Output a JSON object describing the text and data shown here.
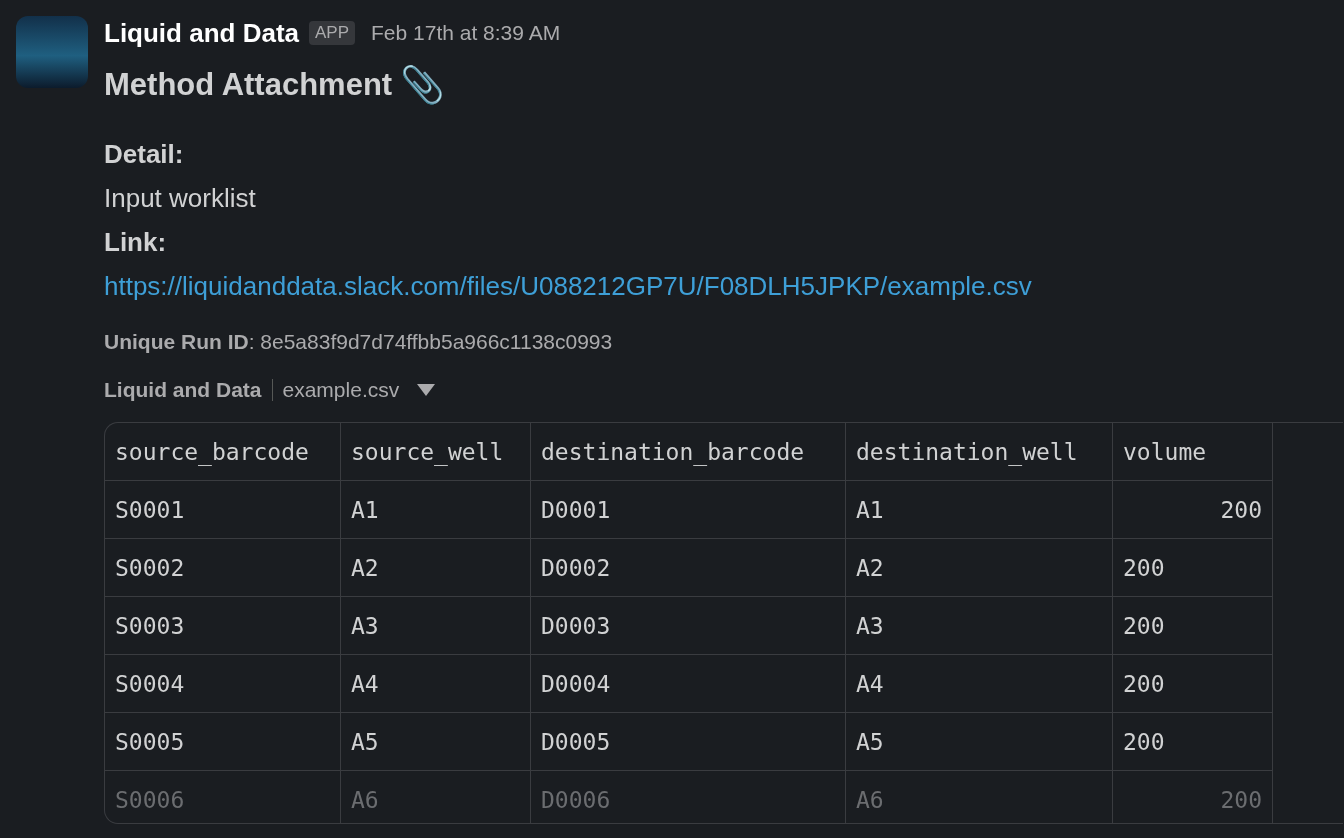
{
  "message": {
    "sender": "Liquid and Data",
    "badge": "APP",
    "time": "Feb 17th at 8:39 AM",
    "title": "Method Attachment",
    "title_emoji": "📎",
    "fields": [
      {
        "label": "Detail:",
        "value": "Input worklist",
        "kind": "text"
      },
      {
        "label": "Link:",
        "value": "https://liquidanddata.slack.com/files/U088212GP7U/F08DLH5JPKP/example.csv",
        "kind": "link"
      }
    ],
    "context": "**Unique Run ID**: 8e5a83f9d7d74ffbb5a966c1138c0993"
  },
  "attachment": {
    "source": "Liquid and Data",
    "filename": "example.csv",
    "table": {
      "columns": [
        "source_barcode",
        "source_well",
        "destination_barcode",
        "destination_well",
        "volume"
      ],
      "rows": [
        {
          "cells": [
            "S0001",
            "A1",
            "D0001",
            "A1",
            "200"
          ],
          "volume_right_aligned": true,
          "faded": false
        },
        {
          "cells": [
            "S0002",
            "A2",
            "D0002",
            "A2",
            "200"
          ],
          "volume_right_aligned": false,
          "faded": false
        },
        {
          "cells": [
            "S0003",
            "A3",
            "D0003",
            "A3",
            "200"
          ],
          "volume_right_aligned": false,
          "faded": false
        },
        {
          "cells": [
            "S0004",
            "A4",
            "D0004",
            "A4",
            "200"
          ],
          "volume_right_aligned": false,
          "faded": false
        },
        {
          "cells": [
            "S0005",
            "A5",
            "D0005",
            "A5",
            "200"
          ],
          "volume_right_aligned": false,
          "faded": false
        },
        {
          "cells": [
            "S0006",
            "A6",
            "D0006",
            "A6",
            "200"
          ],
          "volume_right_aligned": true,
          "faded": true
        }
      ]
    }
  }
}
